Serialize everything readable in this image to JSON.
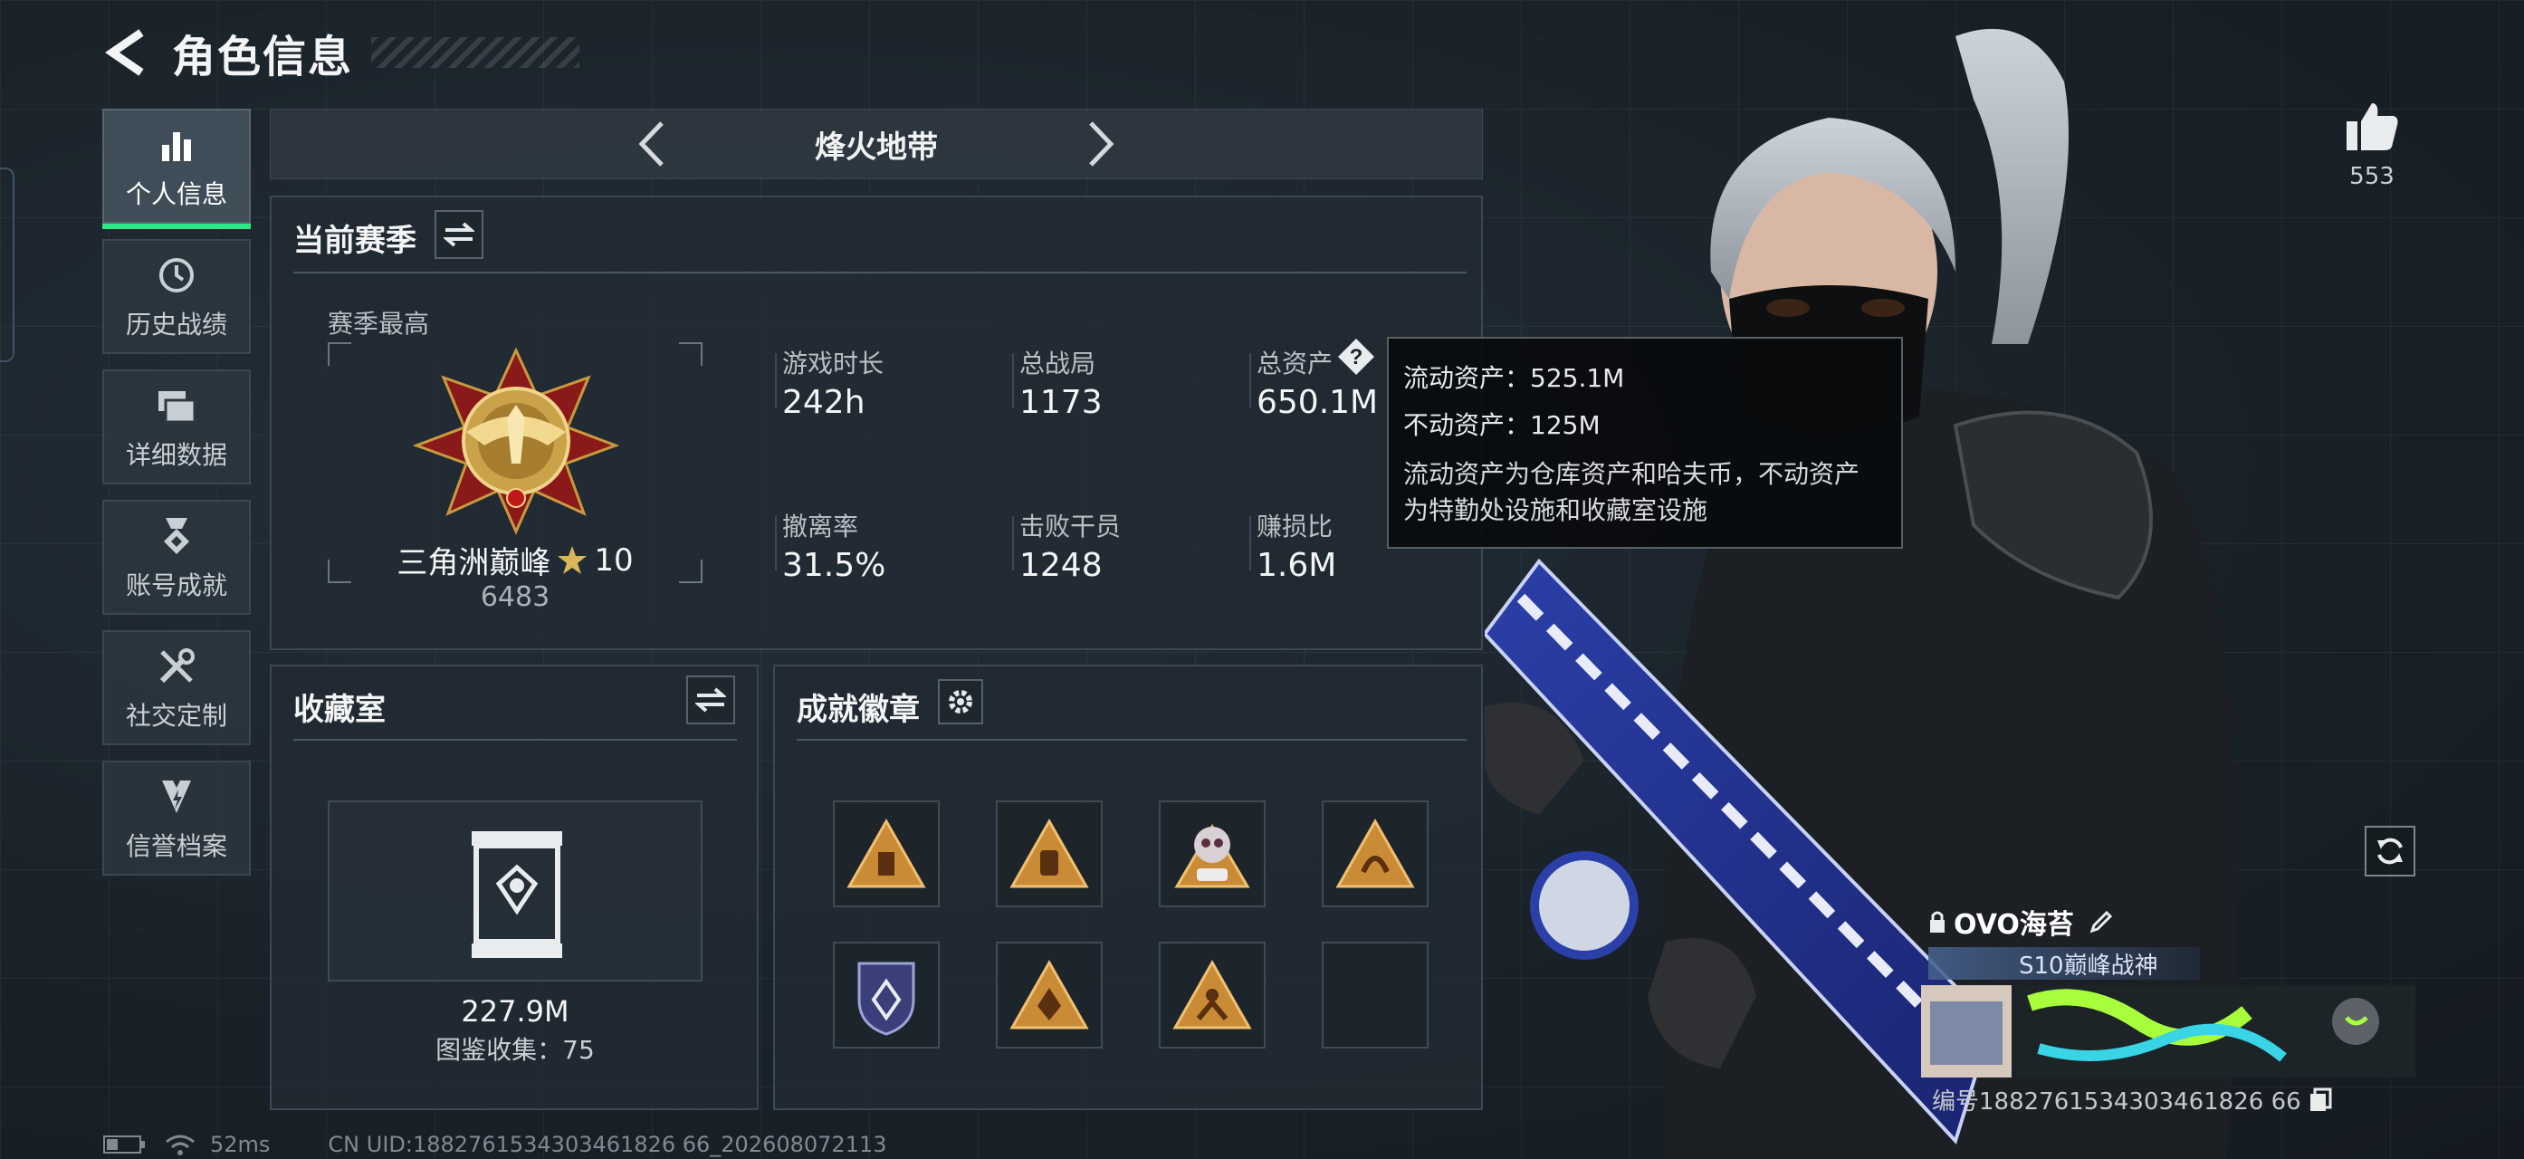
{
  "header": {
    "title": "角色信息"
  },
  "sidebar": {
    "items": [
      {
        "label": "个人信息",
        "icon": "bar-chart-icon",
        "active": true
      },
      {
        "label": "历史战绩",
        "icon": "clock-icon"
      },
      {
        "label": "详细数据",
        "icon": "folders-icon"
      },
      {
        "label": "账号成就",
        "icon": "medal-icon"
      },
      {
        "label": "社交定制",
        "icon": "tools-icon"
      },
      {
        "label": "信誉档案",
        "icon": "shield-bolt-icon"
      }
    ]
  },
  "mode": {
    "title": "烽火地带"
  },
  "season": {
    "title": "当前赛季",
    "best_label": "赛季最高",
    "rank_name": "三角洲巅峰",
    "rank_stars": "10",
    "rank_score": "6483",
    "stats": [
      {
        "label": "游戏时长",
        "value": "242h"
      },
      {
        "label": "总战局",
        "value": "1173"
      },
      {
        "label": "总资产",
        "value": "650.1M"
      },
      {
        "label": "撤离率",
        "value": "31.5%"
      },
      {
        "label": "击败干员",
        "value": "1248"
      },
      {
        "label": "赚损比",
        "value": "1.6M"
      }
    ]
  },
  "tooltip": {
    "liquid": "流动资产：525.1M",
    "fixed": "不动资产：125M",
    "desc1": "流动资产为仓库资产和哈夫币，不动资产",
    "desc2": "为特勤处设施和收藏室设施"
  },
  "collection": {
    "title": "收藏室",
    "value": "227.9M",
    "catalog": "图鉴收集：75"
  },
  "badges": {
    "title": "成就徽章",
    "slots": [
      "badge-1",
      "badge-2",
      "badge-3",
      "badge-4",
      "badge-5",
      "badge-6",
      "badge-7",
      "empty"
    ]
  },
  "likes": {
    "count": "553"
  },
  "player": {
    "name": "OVO海苔",
    "title": "S10巅峰战神",
    "uid": "编号1882761534303461826 66"
  },
  "footer": {
    "ping": "52ms",
    "uid": "CN UID:1882761534303461826 66_202608072113"
  },
  "colors": {
    "accent": "#2ee887",
    "gold": "#c9a24a",
    "bg": "#1a2128"
  }
}
